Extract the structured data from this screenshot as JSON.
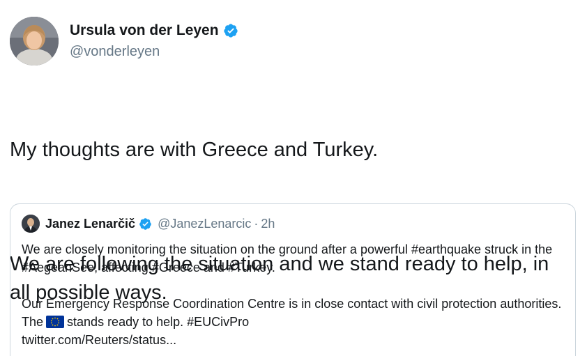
{
  "tweet": {
    "author": {
      "name": "Ursula von der Leyen",
      "handle": "@vonderleyen",
      "verified_icon": "verified-badge-icon",
      "verified_color": "#1da1f2"
    },
    "paragraphs": [
      "My thoughts are with Greece and Turkey.",
      "We are following the situation and we stand ready to help, in all possible ways."
    ]
  },
  "quoted_tweet": {
    "author": {
      "name": "Janez Lenarčič",
      "handle": "@JanezLenarcic",
      "separator": "·",
      "time": "2h"
    },
    "paragraph_1": "We are closely monitoring the situation on the ground after a powerful #earthquake struck in the #AegeanSee, affecting #Greece and #Turkey.",
    "paragraph_2_before": "Our Emergency Response Coordination Centre is in close contact with civil protection authorities. The",
    "paragraph_2_emoji": "eu-flag-icon",
    "paragraph_2_after": "stands ready to help. #EUCivPro",
    "link": "twitter.com/Reuters/status..."
  },
  "colors": {
    "text_primary": "#14171a",
    "text_secondary": "#657786",
    "border": "#ccd6dd",
    "eu_blue": "#003399",
    "eu_yellow": "#ffcc00"
  }
}
